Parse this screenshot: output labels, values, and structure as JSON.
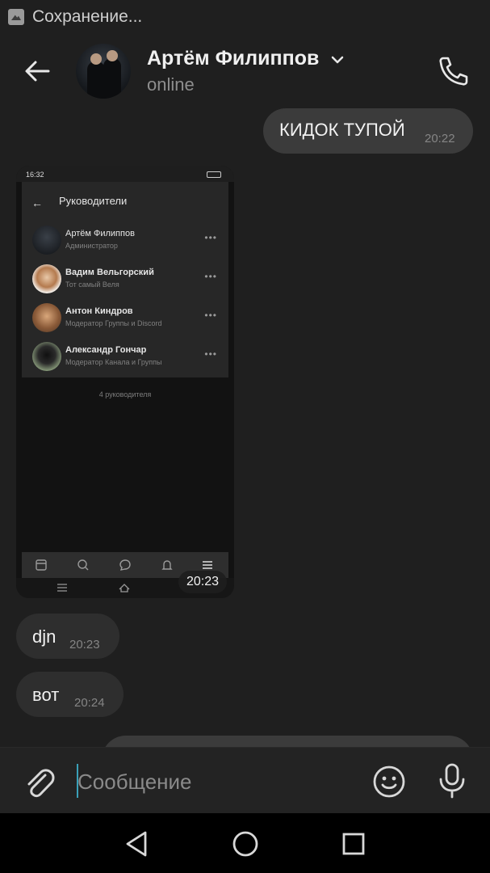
{
  "status_bar": {
    "text": "Сохранение..."
  },
  "header": {
    "name": "Артём Филиппов",
    "status": "online"
  },
  "messages": [
    {
      "dir": "out",
      "text": "КИДОК ТУПОЙ",
      "time": "20:22"
    },
    {
      "dir": "in",
      "type": "photo",
      "time": "20:23"
    },
    {
      "dir": "in",
      "text": "djn",
      "time": "20:23"
    },
    {
      "dir": "in",
      "text": "вот",
      "time": "20:24"
    }
  ],
  "screenshot": {
    "status_time": "16:32",
    "title": "Руководители",
    "members": [
      {
        "name": "Артём Филиппов",
        "role": "Администратор"
      },
      {
        "name": "Вадим Вельгорский",
        "role": "Тот самый Веля"
      },
      {
        "name": "Антон Киндров",
        "role": "Модератор Группы и Discord"
      },
      {
        "name": "Александр Гончар",
        "role": "Модератор Канала и Группы"
      }
    ],
    "count": "4 руководителя"
  },
  "composer": {
    "placeholder": "Сообщение"
  },
  "colors": {
    "accent": "#3aa0b8",
    "bubble_out": "#3b3b3b",
    "bubble_in": "#2e2e2e",
    "background": "#1f1f1f"
  },
  "icons": [
    "back-arrow-icon",
    "chevron-down-icon",
    "phone-icon",
    "paperclip-icon",
    "smile-icon",
    "microphone-icon",
    "nav-back-icon",
    "nav-home-icon",
    "nav-recents-icon"
  ]
}
